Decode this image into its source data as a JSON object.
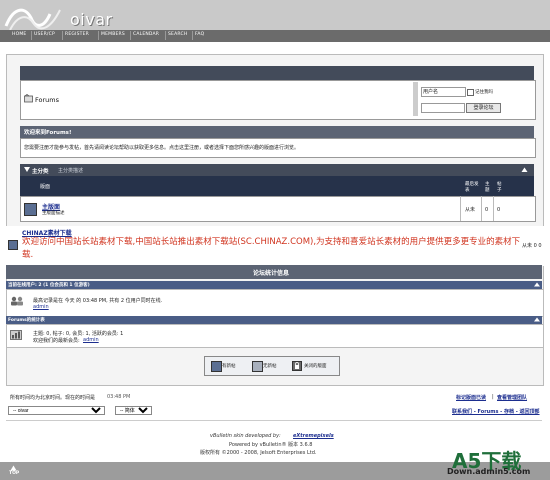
{
  "header": {
    "logo_text": "oivar",
    "nav": [
      "HOME",
      "USER/CP",
      "REGISTER",
      "MEMBERS",
      "CALENDAR",
      "SEARCH",
      "FAQ"
    ]
  },
  "forum_home": {
    "title": "Forums",
    "username_label": "用户名",
    "remember_me": "记住我吗",
    "password_label": "密码",
    "login_button": "登录论坛"
  },
  "welcome": {
    "heading": "欢迎来到Forums!",
    "text": "您需要注册才能参与发帖，首先请阅读论坛帮助以获取更多信息。点击这里注册，或者选择下面您所感兴趣的版面进行浏览。"
  },
  "category": {
    "title": "主分类",
    "subtitle": "主分类描述",
    "col_forum": "版面",
    "col_last": "最后发表",
    "col_topics": "主题",
    "col_posts": "帖子",
    "forum_name": "主版面",
    "forum_desc": "主版面描述",
    "forum_last": "从未",
    "forum_topics": "0",
    "forum_posts": "0"
  },
  "ad": {
    "site_link": "CHINAZ素材下载",
    "text": "欢迎访问中国站长站素材下载,中国站长站推出素材下载站(SC.CHINAZ.COM),为支持和喜爱站长素材的用户提供更多更专业的素材下载.",
    "right": "从未 0 0"
  },
  "stats": {
    "title": "论坛统计信息",
    "online_header": "当前在线用户: 2 (1 位会员和 1 位游客)",
    "online_text": "最高记录是在 今天 的 03:48 PM, 共有 2 位用户同时在线.",
    "online_user": "admin",
    "forum_stats_header": "Forums的统计表",
    "forum_stats_text": "主题: 0, 帖子: 0, 会员: 1, 活跃的会员: 1",
    "newest_member_text": "欢迎我们的最新会员:",
    "newest_member": "admin"
  },
  "legend": {
    "new": "有新帖",
    "none": "无新帖",
    "closed": "关闭的版面"
  },
  "footer": {
    "timezone_text": "所有时间均为北京时间。现在的时间是",
    "time": "03:48 PM",
    "mark_read": "标记版面已读",
    "view_leaders": "查看管理团队",
    "style_select": "-- oivar",
    "lang_select": "-- 简体中文",
    "contact_links": "联系我们 - Forums - 存档 - 返回顶部",
    "skin_credit": "vBulletin skin developed by:",
    "skin_author": "eXtremepixels",
    "powered": "Powered by vBulletin® 版本 3.6.8",
    "copyright": "版权所有 ©2000 - 2008, Jelsoft Enterprises Ltd.",
    "top": "TOP"
  },
  "watermark": {
    "brand": "A5下载",
    "url": "Down.admin5.com"
  }
}
